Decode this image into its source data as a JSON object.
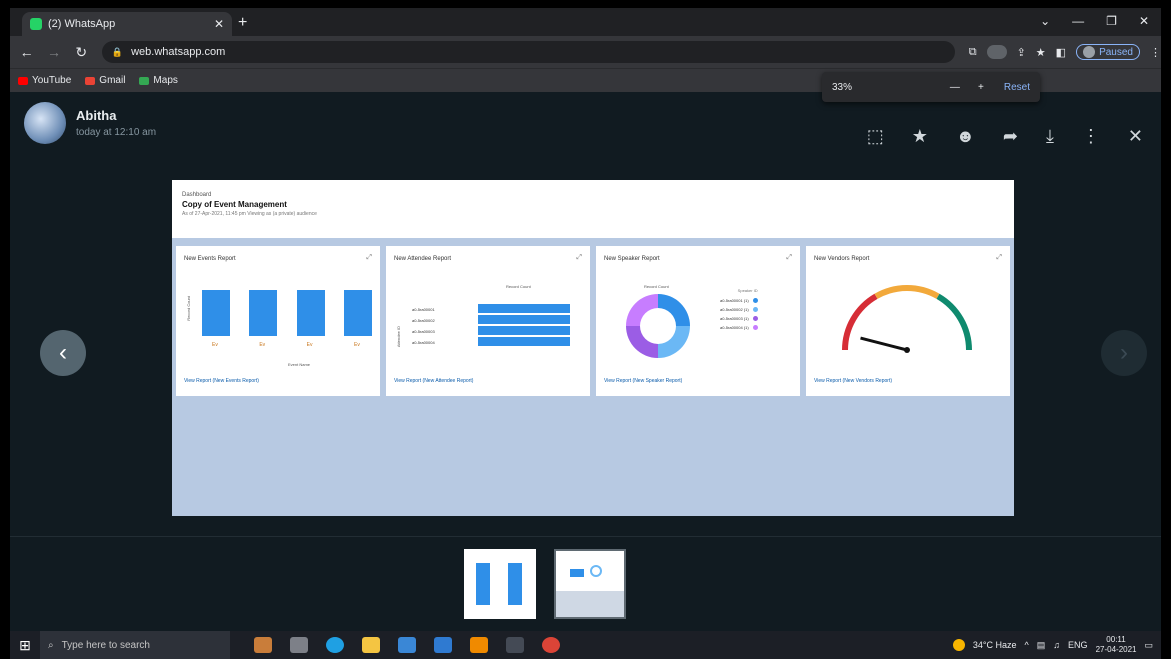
{
  "browser": {
    "tab_title": "(2) WhatsApp",
    "tab_close": "✕",
    "new_tab": "+",
    "url": "web.whatsapp.com",
    "paused_label": "Paused",
    "window_controls": [
      "⌄",
      "—",
      "❐",
      "✕"
    ]
  },
  "bookmarks": [
    {
      "label": "YouTube",
      "color": "#ff0000"
    },
    {
      "label": "Gmail",
      "color": "#ea4335"
    },
    {
      "label": "Maps",
      "color": "#34a853"
    }
  ],
  "zoom_popup": {
    "value": "33%",
    "minus": "—",
    "plus": "+",
    "reset": "Reset"
  },
  "viewer": {
    "sender_name": "Abitha",
    "sender_time": "today at 12:10 am"
  },
  "shot": {
    "crumb": "Dashboard",
    "title": "Copy of Event Management",
    "subtitle": "As of 27-Apr-2021, 11:45 pm Viewing as (a private) audience",
    "cards": [
      {
        "title": "New Events Report",
        "link": "View Report (New Events Report)"
      },
      {
        "title": "New Attendee Report",
        "link": "View Report (New Attendee Report)"
      },
      {
        "title": "New Speaker Report",
        "link": "View Report (New Speaker Report)"
      },
      {
        "title": "New Vendors Report",
        "link": "View Report (New Vendors Report)"
      }
    ]
  },
  "chart_data": [
    {
      "type": "bar",
      "title": "New Events Report",
      "categories": [
        "Ev",
        "Ev",
        "Ev",
        "Ev"
      ],
      "values": [
        1,
        1,
        1,
        1
      ],
      "ylabel": "Record Count",
      "xlabel": "Event Name",
      "ylim": [
        0,
        1
      ]
    },
    {
      "type": "bar",
      "title": "New Attendee Report",
      "categories": [
        "a0-5ra00001",
        "a0-5ra00002",
        "a0-5ra00003",
        "a0-5ra00004"
      ],
      "values": [
        1,
        1,
        1,
        1
      ],
      "legend": "Record Count",
      "ylabel": "Attendee ID"
    },
    {
      "type": "pie",
      "title": "New Speaker Report",
      "legend_title": "Record Count",
      "legend_header": "Speaker ID",
      "labels": [
        "a0-5ra00001 (1)",
        "a0-5ra00002 (1)",
        "a0-5ra00003 (1)",
        "a0-5ra00004 (1)"
      ],
      "values": [
        1,
        1,
        1,
        1
      ],
      "colors": [
        "#2f8fe8",
        "#6bb8f5",
        "#9b5de5",
        "#c77dff"
      ]
    },
    {
      "type": "gauge",
      "title": "New Vendors Report",
      "value": 0.08,
      "bands": [
        "#d62d36",
        "#f2a93b",
        "#0f8a6e"
      ]
    }
  ],
  "taskbar": {
    "search_placeholder": "Type here to search",
    "weather": "34°C Haze",
    "lang": "ENG",
    "time": "00:11",
    "date": "27-04-2021"
  }
}
